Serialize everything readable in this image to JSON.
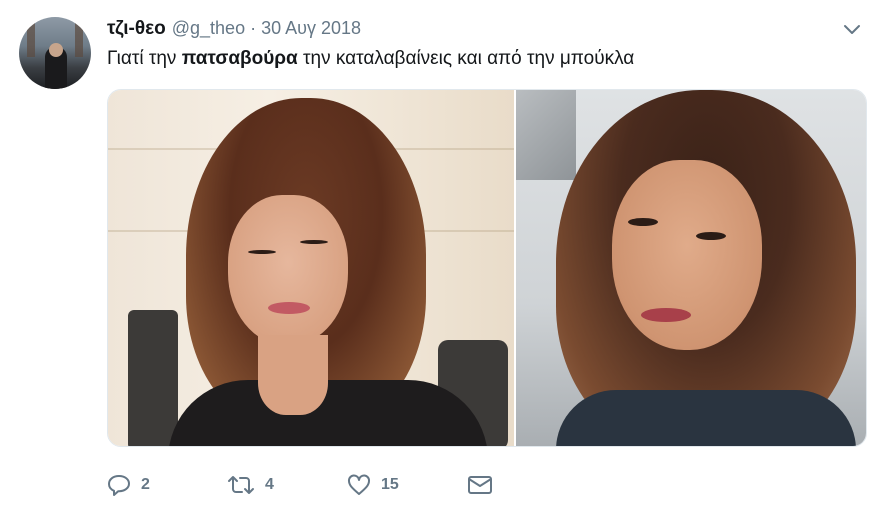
{
  "tweet": {
    "display_name": "τζι-θεο",
    "handle": "@g_theo",
    "separator": "·",
    "date": "30 Αυγ 2018",
    "text_before": "Γιατί την ",
    "text_bold": "πατσαβούρα",
    "text_after": " την καταλαβαίνεις και από την μπούκλα"
  },
  "actions": {
    "replies": "2",
    "retweets": "4",
    "likes": "15"
  },
  "icons": {
    "caret": "chevron-down-icon",
    "reply": "reply-icon",
    "retweet": "retweet-icon",
    "like": "heart-icon",
    "message": "envelope-icon"
  },
  "colors": {
    "text": "#14171a",
    "secondary": "#657786",
    "border": "#e1e8ed"
  }
}
